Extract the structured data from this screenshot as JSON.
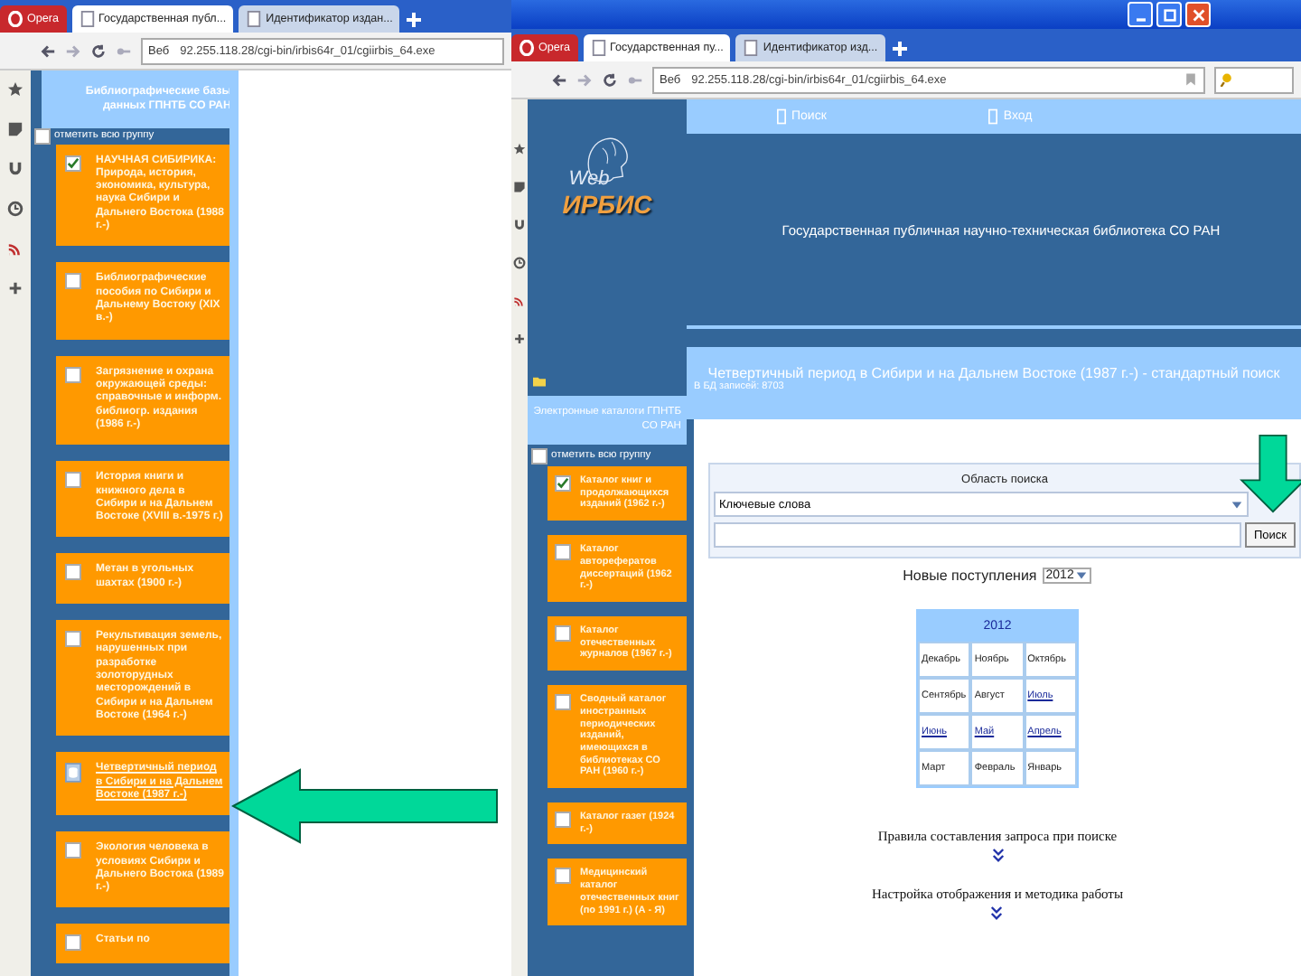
{
  "back_window": {
    "tabs": [
      {
        "label": "Opera",
        "kind": "menu",
        "selected": false
      },
      {
        "label": "Государственная публ...",
        "kind": "page",
        "selected": true
      },
      {
        "label": "Идентификатор издан...",
        "kind": "page",
        "selected": false
      }
    ],
    "address": {
      "badge": "Веб",
      "url": "92.255.118.28/cgi-bin/irbis64r_01/cgiirbis_64.exe"
    },
    "panel": {
      "title": "Библиографические базы данных ГПНТБ СО РАН",
      "select_all": {
        "label": "отметить всю группу",
        "checked": false
      },
      "items": [
        {
          "label": "НАУЧНАЯ СИБИРИКА: Природа, история, экономика, культура, наука Сибири и Дальнего Востока (1988 г.-)",
          "checked": true,
          "selected": false
        },
        {
          "label": "Библиографические пособия по Сибири и Дальнему Востоку (XIX в.-)",
          "checked": false,
          "selected": false
        },
        {
          "label": "Загрязнение и охрана окружающей среды: справочные и информ. библиогр. издания (1986 г.-)",
          "checked": false,
          "selected": false
        },
        {
          "label": "История книги и книжного дела в Сибири и на Дальнем Востоке (XVIII в.-1975 г.)",
          "checked": false,
          "selected": false
        },
        {
          "label": "Метан в угольных шахтах (1900 г.-)",
          "checked": false,
          "selected": false
        },
        {
          "label": "Рекультивация земель, нарушенных при разработке золоторудных месторождений в Сибири и на Дальнем Востоке (1964 г.-)",
          "checked": false,
          "selected": false
        },
        {
          "label": "Четвертичный период в Сибири и на Дальнем Востоке (1987 г.-)",
          "selected": true
        },
        {
          "label": "Экология человека в условиях Сибири и Дальнего Востока (1989 г.-)",
          "checked": false,
          "selected": false
        },
        {
          "label": "Статьи по",
          "checked": false,
          "selected": false
        }
      ]
    }
  },
  "front_window": {
    "tabs": [
      {
        "label": "Opera",
        "kind": "menu",
        "selected": false
      },
      {
        "label": "Государственная пу...",
        "kind": "page",
        "selected": true
      },
      {
        "label": "Идентификатор изд...",
        "kind": "page",
        "selected": false
      }
    ],
    "address": {
      "badge": "Веб",
      "url": "92.255.118.28/cgi-bin/irbis64r_01/cgiirbis_64.exe"
    },
    "nav": [
      "Поиск",
      "Вход"
    ],
    "logo": {
      "top": "Web",
      "bottom": "ИРБИС"
    },
    "title": "Государственная публичная научно-техническая библиотека СО РАН",
    "panel": {
      "title": "Электронные каталоги ГПНТБ СО РАН",
      "select_all": {
        "label": "отметить всю группу",
        "checked": false
      },
      "items": [
        {
          "label": "Каталог книг и продолжающихся изданий (1962 г.-)",
          "checked": true,
          "selected": false
        },
        {
          "label": "Каталог авторефератов диссертаций (1962 г.-)",
          "checked": false,
          "selected": false
        },
        {
          "label": "Каталог отечественных журналов (1967 г.-)",
          "checked": false,
          "selected": false
        },
        {
          "label": "Сводный каталог иностранных периодических изданий, имеющихся в библиотеках СО РАН (1960 г.-)",
          "checked": false,
          "selected": false
        },
        {
          "label": "Каталог газет (1924 г.-)",
          "checked": false,
          "selected": false
        },
        {
          "label": "Медицинский каталог отечественных книг (по 1991 г.) (А - Я)",
          "checked": false,
          "selected": false
        }
      ]
    },
    "heading": "Четвертичный период в Сибири и на Дальнем Востоке (1987 г.-) - стандартный поиск",
    "record_count": "В БД записей: 8703",
    "search": {
      "label": "Область поиска",
      "scope": "Ключевые слова",
      "button": "Поиск"
    },
    "new_arrivals": {
      "label": "Новые поступления",
      "year": "2012"
    },
    "calendar": {
      "title": "2012",
      "cells": [
        {
          "text": "Декабрь",
          "link": false
        },
        {
          "text": "Ноябрь",
          "link": false
        },
        {
          "text": "Октябрь",
          "link": false
        },
        {
          "text": "Сентябрь",
          "link": false
        },
        {
          "text": "Август",
          "link": false
        },
        {
          "text": "Июль",
          "link": true
        },
        {
          "text": "Июнь",
          "link": true
        },
        {
          "text": "Май",
          "link": true
        },
        {
          "text": "Апрель",
          "link": true
        },
        {
          "text": "Март",
          "link": false
        },
        {
          "text": "Февраль",
          "link": false
        },
        {
          "text": "Январь",
          "link": false
        }
      ]
    },
    "links": [
      "Правила составления запроса при поиске",
      "Настройка отображения и методика работы"
    ]
  }
}
